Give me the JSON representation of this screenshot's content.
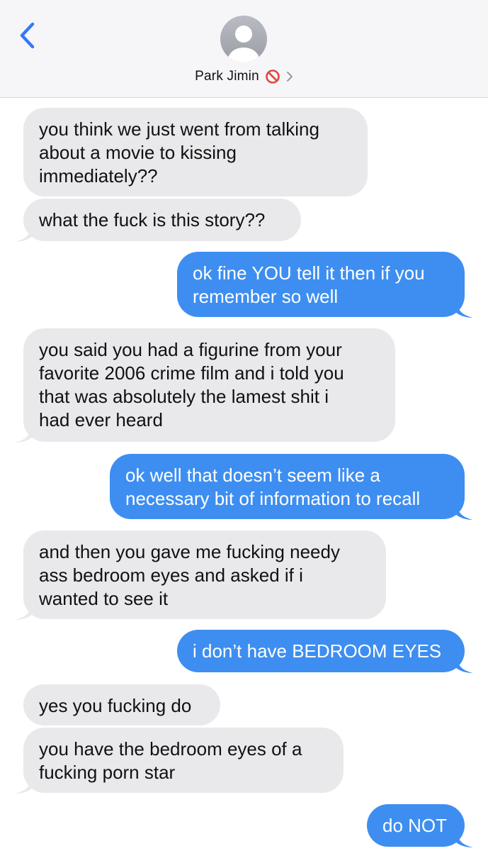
{
  "header": {
    "contact_name": "Park Jimin",
    "accent_color": "#3478f6",
    "icons": [
      "chevron-left-icon",
      "person-avatar-icon",
      "blocked-icon",
      "chevron-right-icon"
    ]
  },
  "messages": [
    {
      "side": "received",
      "lines": [
        "you think we just went from talking",
        "about a movie to kissing",
        "immediately??"
      ]
    },
    {
      "side": "received",
      "lines": [
        "what the fuck is this story??"
      ]
    },
    {
      "side": "sent",
      "lines": [
        "ok fine YOU tell it then if you",
        "remember so well"
      ]
    },
    {
      "side": "received",
      "lines": [
        "you said you had a figurine from your",
        "favorite 2006 crime film and i told you",
        "that was absolutely the lamest shit i",
        "had ever heard"
      ]
    },
    {
      "side": "sent",
      "lines": [
        "ok well that doesn’t seem like a",
        "necessary bit of information to recall"
      ]
    },
    {
      "side": "received",
      "lines": [
        "and then you gave me fucking needy",
        "ass bedroom eyes and asked if i",
        "wanted to see it"
      ]
    },
    {
      "side": "sent",
      "lines": [
        "i don’t have BEDROOM EYES"
      ]
    },
    {
      "side": "received",
      "lines": [
        "yes you fucking do"
      ]
    },
    {
      "side": "received",
      "lines": [
        "you have the bedroom eyes of a",
        "fucking porn star"
      ]
    },
    {
      "side": "sent",
      "lines": [
        "do NOT"
      ]
    }
  ]
}
